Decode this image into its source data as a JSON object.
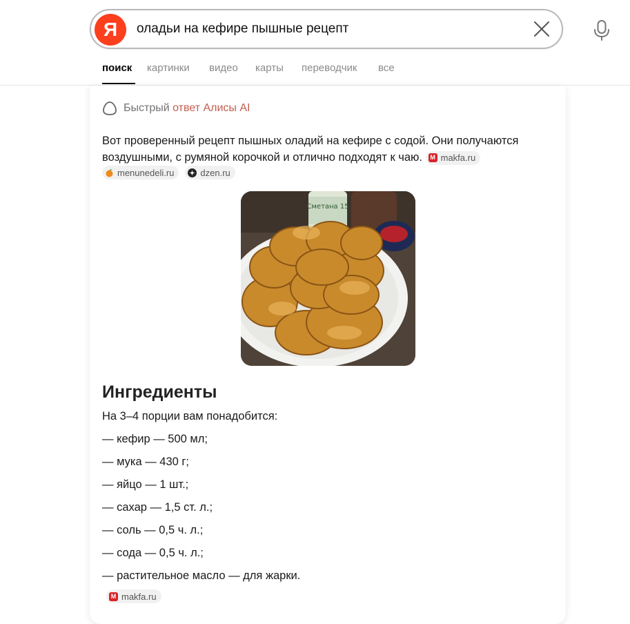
{
  "search": {
    "logo_letter": "Я",
    "query": "оладьи на кефире пышные рецепт"
  },
  "tabs": [
    {
      "label": "поиск",
      "active": true
    },
    {
      "label": "картинки"
    },
    {
      "label": "видео"
    },
    {
      "label": "карты"
    },
    {
      "label": "переводчик"
    },
    {
      "label": "все"
    }
  ],
  "answer": {
    "header_prefix": "Быстрый",
    "header_accent": "ответ Алисы AI",
    "text": "Вот проверенный рецепт пышных оладий на кефире с содой. Они получаются воздушными, с румяной корочкой и отлично подходят к чаю.",
    "sources_inline": [
      "makfa.ru"
    ],
    "sources_row": [
      "menunedeli.ru",
      "dzen.ru"
    ],
    "image_label": "Сметана 15"
  },
  "ingredients": {
    "heading": "Ингредиенты",
    "intro": "На 3–4 порции вам понадобится:",
    "items": [
      "— кефир — 500 мл;",
      "— мука — 430 г;",
      "— яйцо — 1 шт.;",
      "— сахар — 1,5 ст. л.;",
      "— соль — 0,5 ч. л.;",
      "— сода — 0,5 ч. л.;",
      "— растительное масло — для жарки."
    ],
    "source": "makfa.ru"
  },
  "colors": {
    "brand": "#fc3f1d",
    "accent_text": "#c45d4d",
    "chip_bg": "#f1f1f1"
  }
}
